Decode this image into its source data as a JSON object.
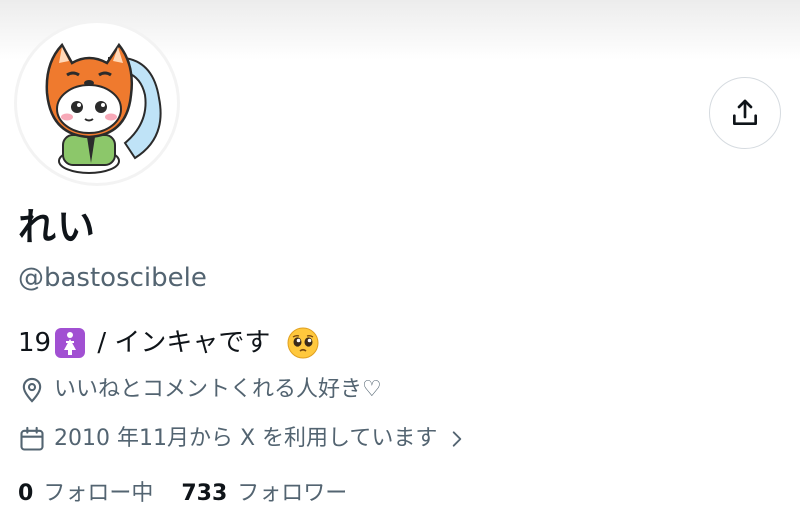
{
  "profile": {
    "name": "れい",
    "handle": "@bastoscibele",
    "bio": {
      "prefix": "19",
      "emoji_1": "restroom-icon",
      "text": " / インキャです ",
      "emoji_2": "pleading-face-icon"
    },
    "location": "いいねとコメントくれる人好き♡",
    "joined": "2010 年11月から X を利用しています",
    "following": {
      "count": "0",
      "label": "フォロー中"
    },
    "followers": {
      "count": "733",
      "label": "フォロワー"
    }
  },
  "icons": {
    "share": "share-icon",
    "location": "location-pin-icon",
    "calendar": "calendar-icon",
    "chevron": "chevron-right-icon",
    "avatar": "fox-hood-character-avatar"
  },
  "colors": {
    "text": "#0f1419",
    "secondary": "#536471",
    "border": "#d6dbe0",
    "emoji_badge": "#a150d2"
  }
}
